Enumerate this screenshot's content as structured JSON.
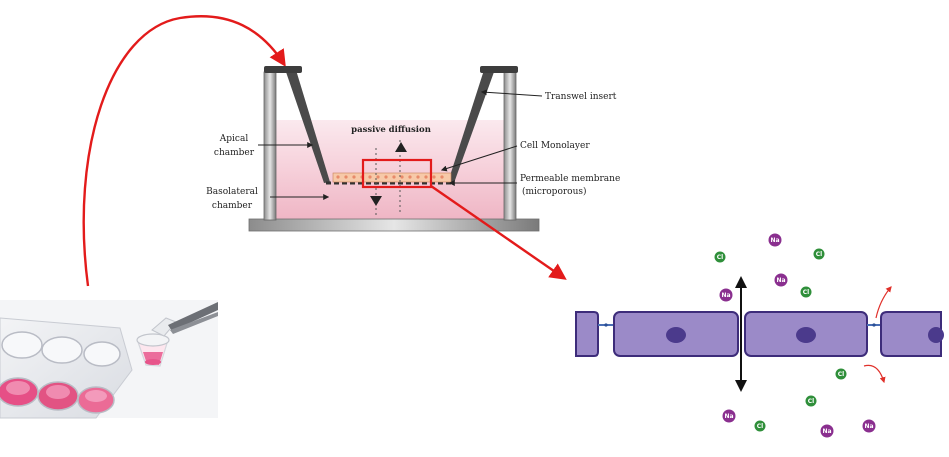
{
  "labels": {
    "transwell_insert": "Transwel insert",
    "apical_line1": "Apical",
    "apical_line2": "chamber",
    "basolateral_line1": "Basolateral",
    "basolateral_line2": "chamber",
    "passive_diffusion": "passive diffusion",
    "cell_monolayer": "Cell Monolayer",
    "membrane_line1": "Permeable membrane",
    "membrane_line2": "(microporous)"
  },
  "ions": [
    {
      "symbol": "Na",
      "kind": "na"
    },
    {
      "symbol": "Cl",
      "kind": "cl"
    },
    {
      "symbol": "Cl",
      "kind": "cl"
    },
    {
      "symbol": "Na",
      "kind": "na"
    },
    {
      "symbol": "Na",
      "kind": "na"
    },
    {
      "symbol": "Cl",
      "kind": "cl"
    },
    {
      "symbol": "Cl",
      "kind": "cl"
    },
    {
      "symbol": "Cl",
      "kind": "cl"
    },
    {
      "symbol": "Na",
      "kind": "na"
    },
    {
      "symbol": "Cl",
      "kind": "cl"
    },
    {
      "symbol": "Na",
      "kind": "na"
    },
    {
      "symbol": "Na",
      "kind": "na"
    }
  ],
  "colors": {
    "arrow_red": "#e31b1b",
    "medium_pink": "#f4c9d3",
    "cell_fill": "#9b8ac8",
    "cell_border": "#3d2c7a",
    "nucleus": "#4b3a8c",
    "na_ion": "#8a2f8f",
    "cl_ion": "#2f8f3a"
  }
}
